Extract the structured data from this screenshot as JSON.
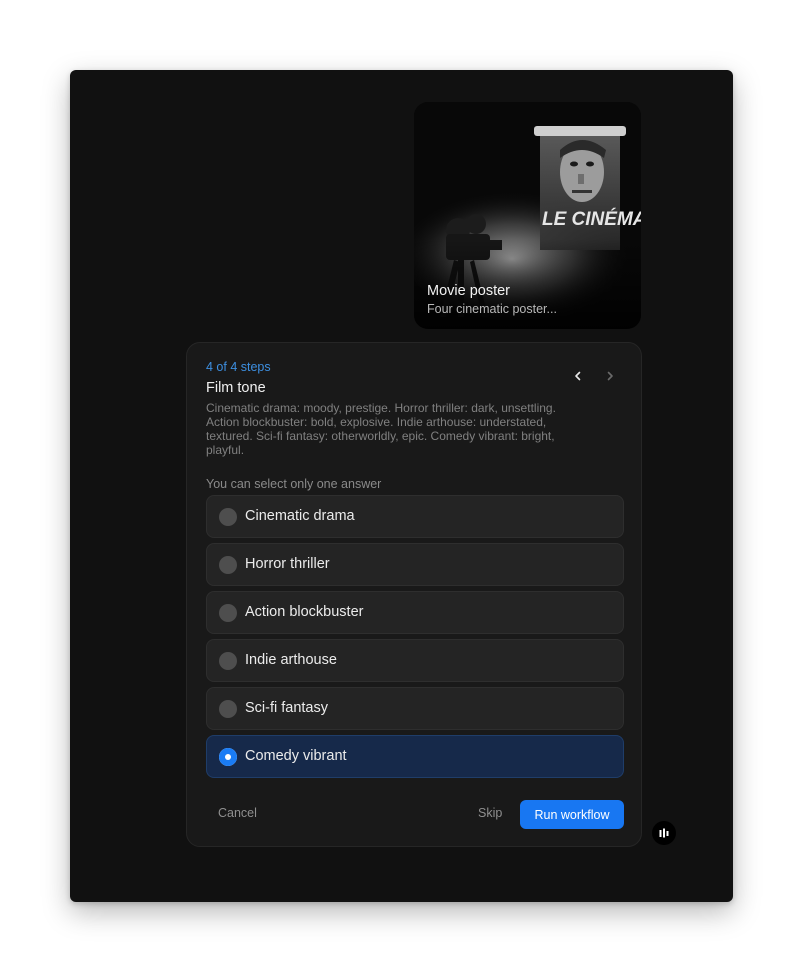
{
  "poster": {
    "title": "Movie poster",
    "subtitle": "Four cinematic poster...",
    "image_text": "LE CINÉMA"
  },
  "wizard": {
    "step": "4 of 4 steps",
    "title": "Film tone",
    "description": "Cinematic drama: moody, prestige. Horror thriller: dark, unsettling. Action blockbuster: bold, explosive. Indie arthouse: understated, textured. Sci-fi fantasy: otherworldly, epic. Comedy vibrant: bright, playful.",
    "hint": "You can select only one answer",
    "options": [
      {
        "label": "Cinematic drama",
        "selected": false
      },
      {
        "label": "Horror thriller",
        "selected": false
      },
      {
        "label": "Action blockbuster",
        "selected": false
      },
      {
        "label": "Indie arthouse",
        "selected": false
      },
      {
        "label": "Sci-fi fantasy",
        "selected": false
      },
      {
        "label": "Comedy vibrant",
        "selected": true
      }
    ],
    "cancel_label": "Cancel",
    "skip_label": "Skip",
    "run_label": "Run workflow",
    "prev_icon": "chevron-left-icon",
    "next_icon": "chevron-right-icon"
  },
  "colors": {
    "accent": "#1877f2",
    "step_text": "#3d8fe0",
    "background": "#111111",
    "card": "#191919"
  },
  "floating_icon": "logo-bars-icon"
}
